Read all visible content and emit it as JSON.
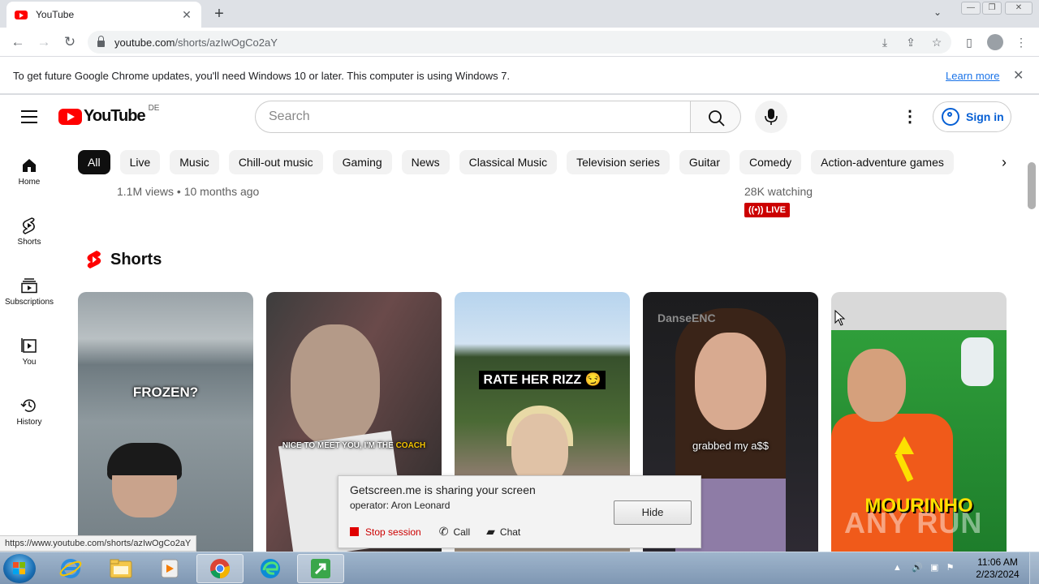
{
  "browser": {
    "tab_title": "YouTube",
    "url_domain": "youtube.com",
    "url_path": "/shorts/azIwOgCo2aY",
    "status_url": "https://www.youtube.com/shorts/azIwOgCo2aY"
  },
  "infobar": {
    "message": "To get future Google Chrome updates, you'll need Windows 10 or later. This computer is using Windows 7.",
    "link": "Learn more"
  },
  "youtube": {
    "logo_text": "YouTube",
    "country": "DE",
    "search_placeholder": "Search",
    "sign_in": "Sign in",
    "sidebar": [
      {
        "label": "Home",
        "icon": "home-icon"
      },
      {
        "label": "Shorts",
        "icon": "shorts-icon"
      },
      {
        "label": "Subscriptions",
        "icon": "subscriptions-icon"
      },
      {
        "label": "You",
        "icon": "library-icon"
      },
      {
        "label": "History",
        "icon": "history-icon"
      }
    ],
    "chips": [
      "All",
      "Live",
      "Music",
      "Chill-out music",
      "Gaming",
      "News",
      "Classical Music",
      "Television series",
      "Guitar",
      "Comedy",
      "Action-adventure games"
    ],
    "video_meta_left": "1.1M views • 10 months ago",
    "video_meta_right": "28K watching",
    "live_badge": "LIVE",
    "shorts_title": "Shorts",
    "shorts": [
      {
        "caption": "FROZEN?"
      },
      {
        "caption": "NICE TO MEET YOU, I'M THE",
        "caption_accent": "COACH"
      },
      {
        "caption": "RATE HER RIZZ 😏"
      },
      {
        "caption": "grabbed my a$$",
        "brand": "DanseENC"
      },
      {
        "caption": "MOURINHO"
      }
    ]
  },
  "popup": {
    "title": "Getscreen.me is sharing your screen",
    "operator": "operator: Aron Leonard",
    "hide": "Hide",
    "stop": "Stop session",
    "call": "Call",
    "chat": "Chat"
  },
  "watermark": "ANY RUN",
  "taskbar": {
    "time": "11:06 AM",
    "date": "2/23/2024"
  },
  "colors": {
    "yt_red": "#ff0000",
    "link_blue": "#065fd4",
    "chip_active": "#0f0f0f",
    "live_red": "#cc0000"
  }
}
